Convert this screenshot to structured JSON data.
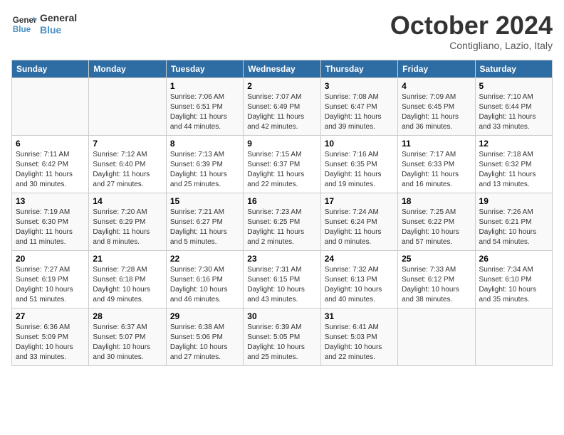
{
  "header": {
    "logo_general": "General",
    "logo_blue": "Blue",
    "month_year": "October 2024",
    "location": "Contigliano, Lazio, Italy"
  },
  "days_of_week": [
    "Sunday",
    "Monday",
    "Tuesday",
    "Wednesday",
    "Thursday",
    "Friday",
    "Saturday"
  ],
  "weeks": [
    [
      {
        "day": "",
        "content": ""
      },
      {
        "day": "",
        "content": ""
      },
      {
        "day": "1",
        "content": "Sunrise: 7:06 AM\nSunset: 6:51 PM\nDaylight: 11 hours and 44 minutes."
      },
      {
        "day": "2",
        "content": "Sunrise: 7:07 AM\nSunset: 6:49 PM\nDaylight: 11 hours and 42 minutes."
      },
      {
        "day": "3",
        "content": "Sunrise: 7:08 AM\nSunset: 6:47 PM\nDaylight: 11 hours and 39 minutes."
      },
      {
        "day": "4",
        "content": "Sunrise: 7:09 AM\nSunset: 6:45 PM\nDaylight: 11 hours and 36 minutes."
      },
      {
        "day": "5",
        "content": "Sunrise: 7:10 AM\nSunset: 6:44 PM\nDaylight: 11 hours and 33 minutes."
      }
    ],
    [
      {
        "day": "6",
        "content": "Sunrise: 7:11 AM\nSunset: 6:42 PM\nDaylight: 11 hours and 30 minutes."
      },
      {
        "day": "7",
        "content": "Sunrise: 7:12 AM\nSunset: 6:40 PM\nDaylight: 11 hours and 27 minutes."
      },
      {
        "day": "8",
        "content": "Sunrise: 7:13 AM\nSunset: 6:39 PM\nDaylight: 11 hours and 25 minutes."
      },
      {
        "day": "9",
        "content": "Sunrise: 7:15 AM\nSunset: 6:37 PM\nDaylight: 11 hours and 22 minutes."
      },
      {
        "day": "10",
        "content": "Sunrise: 7:16 AM\nSunset: 6:35 PM\nDaylight: 11 hours and 19 minutes."
      },
      {
        "day": "11",
        "content": "Sunrise: 7:17 AM\nSunset: 6:33 PM\nDaylight: 11 hours and 16 minutes."
      },
      {
        "day": "12",
        "content": "Sunrise: 7:18 AM\nSunset: 6:32 PM\nDaylight: 11 hours and 13 minutes."
      }
    ],
    [
      {
        "day": "13",
        "content": "Sunrise: 7:19 AM\nSunset: 6:30 PM\nDaylight: 11 hours and 11 minutes."
      },
      {
        "day": "14",
        "content": "Sunrise: 7:20 AM\nSunset: 6:29 PM\nDaylight: 11 hours and 8 minutes."
      },
      {
        "day": "15",
        "content": "Sunrise: 7:21 AM\nSunset: 6:27 PM\nDaylight: 11 hours and 5 minutes."
      },
      {
        "day": "16",
        "content": "Sunrise: 7:23 AM\nSunset: 6:25 PM\nDaylight: 11 hours and 2 minutes."
      },
      {
        "day": "17",
        "content": "Sunrise: 7:24 AM\nSunset: 6:24 PM\nDaylight: 11 hours and 0 minutes."
      },
      {
        "day": "18",
        "content": "Sunrise: 7:25 AM\nSunset: 6:22 PM\nDaylight: 10 hours and 57 minutes."
      },
      {
        "day": "19",
        "content": "Sunrise: 7:26 AM\nSunset: 6:21 PM\nDaylight: 10 hours and 54 minutes."
      }
    ],
    [
      {
        "day": "20",
        "content": "Sunrise: 7:27 AM\nSunset: 6:19 PM\nDaylight: 10 hours and 51 minutes."
      },
      {
        "day": "21",
        "content": "Sunrise: 7:28 AM\nSunset: 6:18 PM\nDaylight: 10 hours and 49 minutes."
      },
      {
        "day": "22",
        "content": "Sunrise: 7:30 AM\nSunset: 6:16 PM\nDaylight: 10 hours and 46 minutes."
      },
      {
        "day": "23",
        "content": "Sunrise: 7:31 AM\nSunset: 6:15 PM\nDaylight: 10 hours and 43 minutes."
      },
      {
        "day": "24",
        "content": "Sunrise: 7:32 AM\nSunset: 6:13 PM\nDaylight: 10 hours and 40 minutes."
      },
      {
        "day": "25",
        "content": "Sunrise: 7:33 AM\nSunset: 6:12 PM\nDaylight: 10 hours and 38 minutes."
      },
      {
        "day": "26",
        "content": "Sunrise: 7:34 AM\nSunset: 6:10 PM\nDaylight: 10 hours and 35 minutes."
      }
    ],
    [
      {
        "day": "27",
        "content": "Sunrise: 6:36 AM\nSunset: 5:09 PM\nDaylight: 10 hours and 33 minutes."
      },
      {
        "day": "28",
        "content": "Sunrise: 6:37 AM\nSunset: 5:07 PM\nDaylight: 10 hours and 30 minutes."
      },
      {
        "day": "29",
        "content": "Sunrise: 6:38 AM\nSunset: 5:06 PM\nDaylight: 10 hours and 27 minutes."
      },
      {
        "day": "30",
        "content": "Sunrise: 6:39 AM\nSunset: 5:05 PM\nDaylight: 10 hours and 25 minutes."
      },
      {
        "day": "31",
        "content": "Sunrise: 6:41 AM\nSunset: 5:03 PM\nDaylight: 10 hours and 22 minutes."
      },
      {
        "day": "",
        "content": ""
      },
      {
        "day": "",
        "content": ""
      }
    ]
  ]
}
